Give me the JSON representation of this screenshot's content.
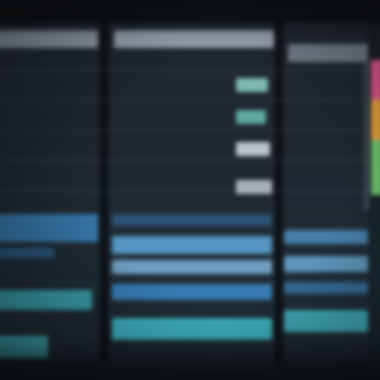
{
  "colors": {
    "background": "#171c20",
    "header": "#a9b6c1",
    "highlight_teal": "#3fb6c4",
    "highlight_blue": "#3a7fb6",
    "highlight_light": "#7fb3d8",
    "status_cell_green": "#8fd3c8",
    "status_cell_white": "#d8e2e8",
    "accent_pink": "#e45a8c",
    "accent_orange": "#e8a23c",
    "accent_green": "#6cc36c"
  },
  "icons": [],
  "text": {}
}
